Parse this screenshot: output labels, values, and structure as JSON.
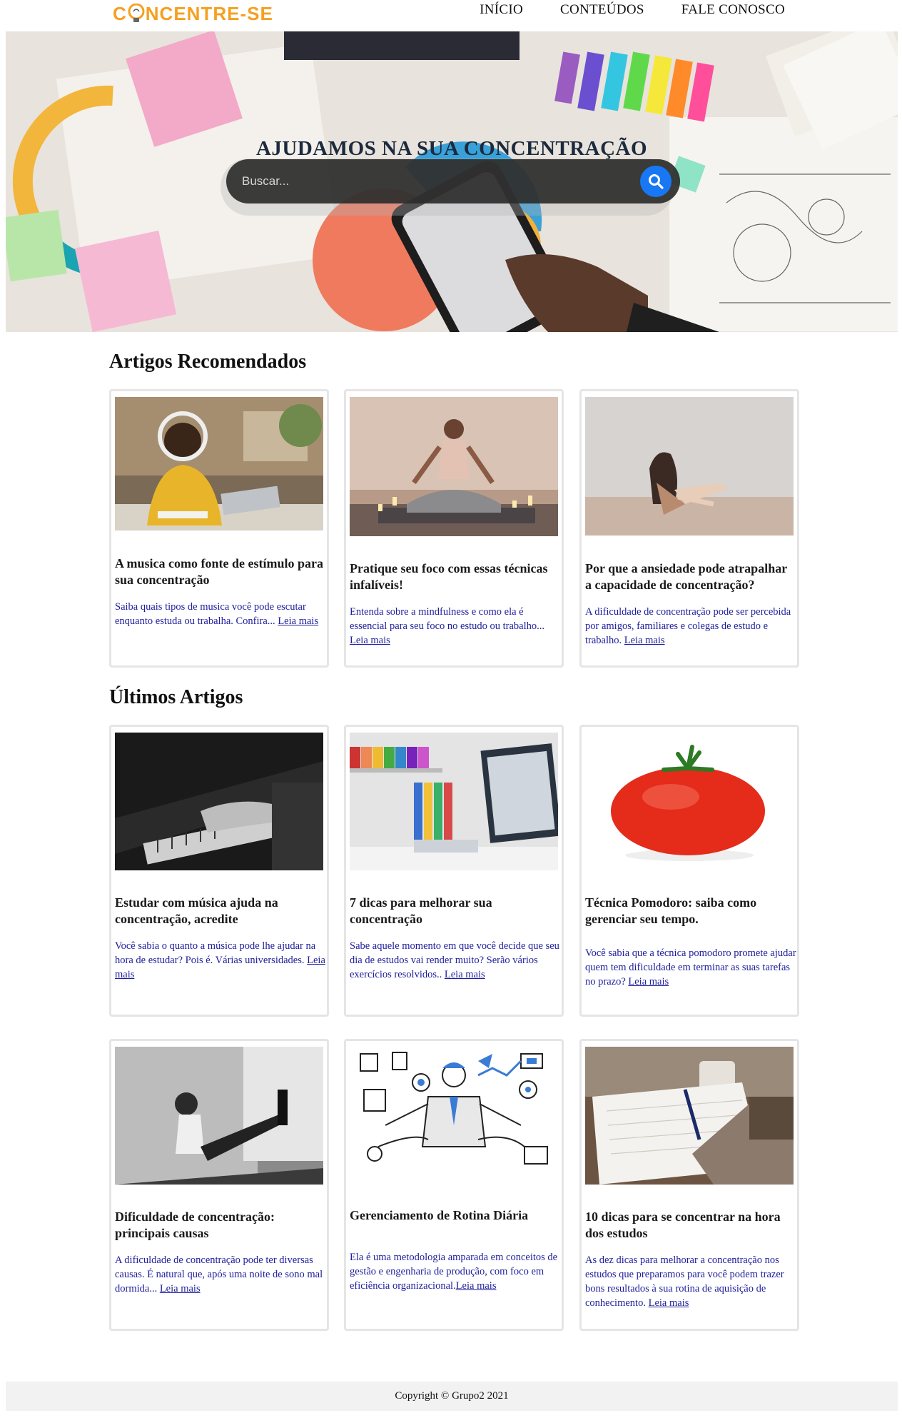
{
  "brand": {
    "logo_text_left": "C",
    "logo_text_right": "NCENTRE-SE",
    "logo_color": "#f5a020"
  },
  "nav": {
    "items": [
      "INÍCIO",
      "CONTEÚDOS",
      "FALE CONOSCO"
    ]
  },
  "hero": {
    "title": "AJUDAMOS NA SUA CONCENTRAÇÃO",
    "search_placeholder": "Buscar...",
    "search_button_color": "#1877f2"
  },
  "recommended": {
    "heading": "Artigos Recomendados",
    "cards": [
      {
        "title": "A musica como fonte de estímulo para sua concentração",
        "text": "Saiba quais tipos de musica você pode escutar enquanto estuda ou trabalha. Confira... ",
        "link": "Leia mais"
      },
      {
        "title": "Pratique seu foco com essas técnicas infalíveis!",
        "text": "Entenda sobre a mindfulness e como ela é essencial para seu foco no estudo ou trabalho... ",
        "link": "Leia mais"
      },
      {
        "title": "Por que a ansiedade pode atrapalhar a capacidade de concentração?",
        "text": "A dificuldade de concentração pode ser percebida por amigos, familiares e colegas de estudo e trabalho. ",
        "link": "Leia mais"
      }
    ]
  },
  "latest": {
    "heading": "Últimos Artigos",
    "cards": [
      {
        "title": "Estudar com música ajuda na concentração, acredite",
        "text": "Você sabia o quanto a música pode lhe ajudar na hora de estudar? Pois é. Várias universidades. ",
        "link": "Leia mais"
      },
      {
        "title": "7 dicas para melhorar sua concentração",
        "text": "Sabe aquele momento em que você decide que seu dia de estudos vai render muito? Serão vários exercícios resolvidos.. ",
        "link": "Leia mais"
      },
      {
        "title": "Técnica Pomodoro: saiba como gerenciar seu tempo.",
        "text": "Você sabia que a técnica pomodoro promete ajudar quem tem dificuldade em terminar as suas tarefas no prazo? ",
        "link": "Leia mais"
      },
      {
        "title": "Dificuldade de concentração: principais causas",
        "text": "A dificuldade de concentração pode ter diversas causas. É natural que, após uma noite de sono mal dormida... ",
        "link": "Leia mais"
      },
      {
        "title": "Gerenciamento de Rotina Diária",
        "text": "Ela é uma metodologia amparada em conceitos de gestão e engenharia de produção, com foco em eficiência organizacional.",
        "link": "Leia mais"
      },
      {
        "title": "10 dicas para se concentrar na hora dos estudos",
        "text": "As dez dicas para melhorar a concentração nos estudos que preparamos para você podem trazer bons resultados à sua rotina de aquisição de conhecimento. ",
        "link": "Leia mais"
      }
    ]
  },
  "footer": {
    "text": "Copyright © Grupo2 2021"
  }
}
